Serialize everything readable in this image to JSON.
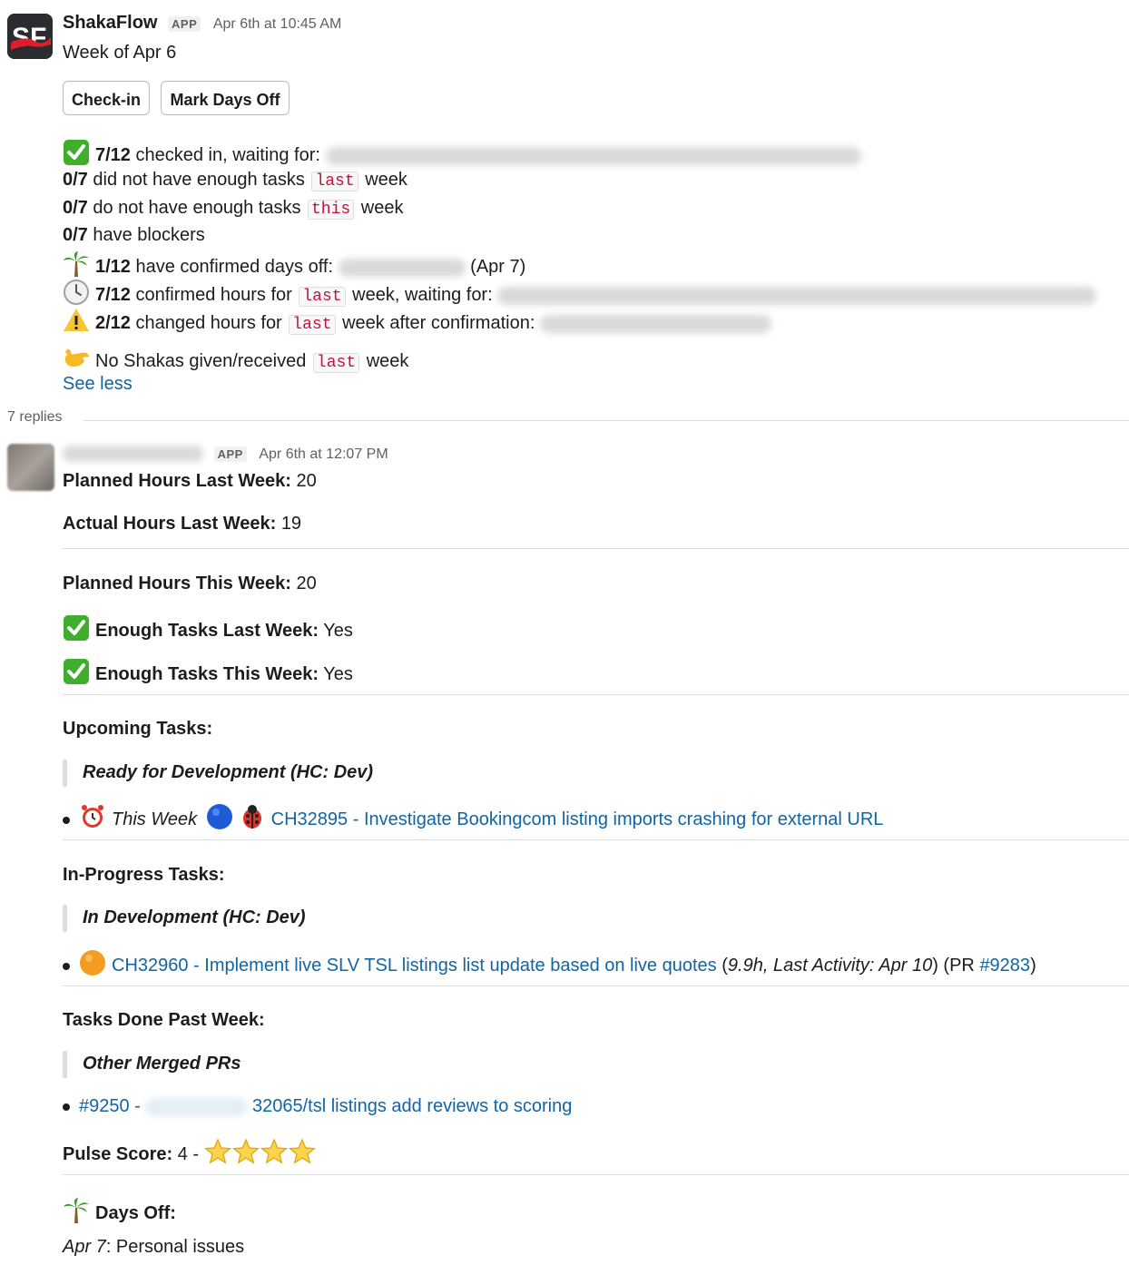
{
  "message": {
    "sender": "ShakaFlow",
    "badge": "APP",
    "timestamp": "Apr 6th at 10:45 AM",
    "title": "Week of Apr 6",
    "buttons": {
      "checkin": "Check-in",
      "mark_days_off": "Mark Days Off"
    },
    "summary": {
      "checked_in_count": "7/12",
      "checked_in_text": "checked in, waiting for:",
      "not_enough_last_count": "0/7",
      "not_enough_last_text": "did not have enough tasks",
      "code_last": "last",
      "code_this": "this",
      "word_week": "week",
      "not_enough_this_count": "0/7",
      "not_enough_this_text": "do not have enough tasks",
      "blockers_count": "0/7",
      "blockers_text": "have blockers",
      "days_off_count": "1/12",
      "days_off_text": "have confirmed days off:",
      "days_off_date": "(Apr 7)",
      "hours_count": "7/12",
      "hours_text": "confirmed hours for",
      "hours_tail": "week, waiting for:",
      "changed_count": "2/12",
      "changed_text": "changed hours for",
      "changed_tail": "week after confirmation:",
      "shakas_text": "No Shakas given/received",
      "see_less": "See less"
    }
  },
  "thread": {
    "replies": "7 replies",
    "reply": {
      "badge": "APP",
      "timestamp": "Apr 6th at 12:07 PM",
      "planned_last_label": "Planned Hours Last Week:",
      "planned_last_value": "20",
      "actual_last_label": "Actual Hours Last Week:",
      "actual_last_value": "19",
      "planned_this_label": "Planned Hours This Week:",
      "planned_this_value": "20",
      "enough_last_label": "Enough Tasks Last Week:",
      "enough_last_value": "Yes",
      "enough_this_label": "Enough Tasks This Week:",
      "enough_this_value": "Yes",
      "upcoming_heading": "Upcoming Tasks:",
      "upcoming_group": "Ready for Development (HC: Dev)",
      "upcoming_when": "This Week",
      "upcoming_link": "CH32895 - Investigate Bookingcom listing imports crashing for external URL",
      "inprogress_heading": "In-Progress Tasks:",
      "inprogress_group": "In Development (HC: Dev)",
      "inprogress_link": "CH32960 - Implement live SLV TSL listings list update based on live quotes",
      "inprogress_open": "(",
      "inprogress_hours": "9.9h",
      "inprogress_activity": ", Last Activity: Apr 10",
      "inprogress_pr_open": ") (PR ",
      "inprogress_pr": "#9283",
      "inprogress_pr_close": ")",
      "done_heading": "Tasks Done Past Week:",
      "done_group": "Other Merged PRs",
      "done_pr": "#9250 -",
      "done_link": "32065/tsl listings add reviews to scoring",
      "pulse_label": "Pulse Score:",
      "pulse_value": "4 -",
      "pulse_stars": 4,
      "days_off_heading": "Days Off:",
      "days_off_date": "Apr 7",
      "days_off_reason": ": Personal issues"
    }
  },
  "colors": {
    "link": "#1264a3",
    "code": "#c0143c",
    "check": "#3fae2a",
    "brand_red": "#e01e2b"
  }
}
